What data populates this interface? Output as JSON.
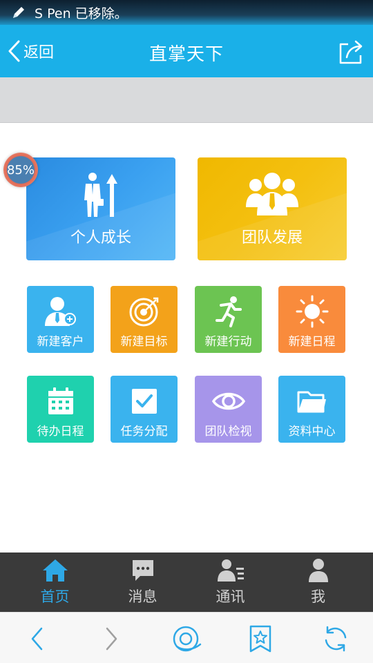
{
  "status_bar": {
    "notification": "S Pen 已移除。"
  },
  "nav": {
    "back_label": "返回",
    "title": "直掌天下"
  },
  "badge": {
    "text": "85%"
  },
  "big_cards": [
    {
      "label": "个人成长",
      "color": "#2f93e6"
    },
    {
      "label": "团队发展",
      "color": "#f2bc08"
    }
  ],
  "tiles": [
    {
      "label": "新建客户",
      "color": "#3ab3ee"
    },
    {
      "label": "新建目标",
      "color": "#f3a21a"
    },
    {
      "label": "新建行动",
      "color": "#6cc452"
    },
    {
      "label": "新建日程",
      "color": "#f98b3c"
    },
    {
      "label": "待办日程",
      "color": "#1fd1ae"
    },
    {
      "label": "任务分配",
      "color": "#3ab3ee"
    },
    {
      "label": "团队检视",
      "color": "#a695ea"
    },
    {
      "label": "资料中心",
      "color": "#3ab3ee"
    }
  ],
  "tabbar": {
    "items": [
      {
        "label": "首页",
        "active": true
      },
      {
        "label": "消息"
      },
      {
        "label": "通讯"
      },
      {
        "label": "我"
      }
    ],
    "active_color": "#2ea8e6"
  }
}
